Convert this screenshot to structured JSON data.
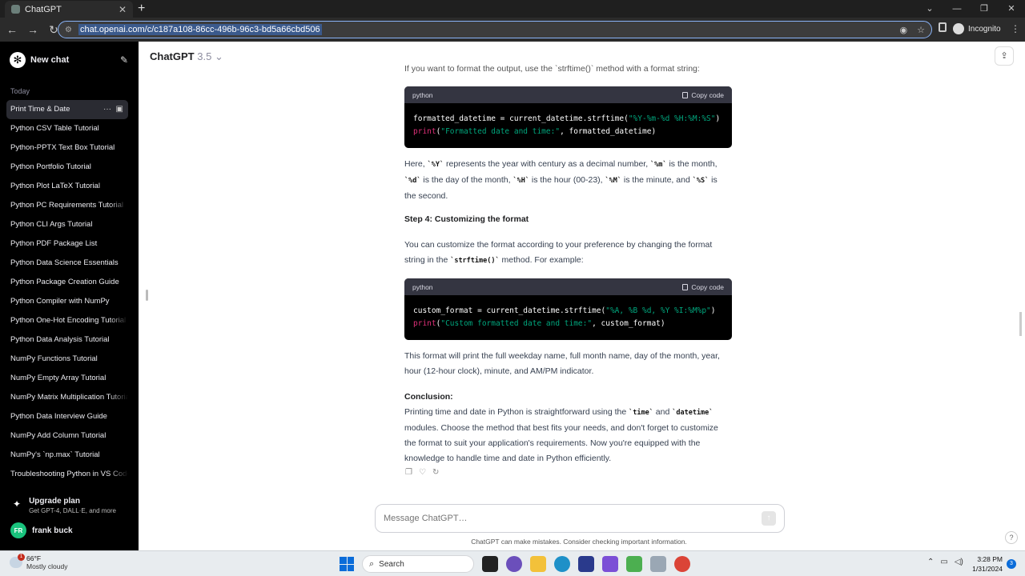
{
  "browser": {
    "tab_title": "ChatGPT",
    "url": "chat.openai.com/c/c187a108-86cc-496b-96c3-bd5a66cbd506",
    "profile_label": "Incognito"
  },
  "sidebar": {
    "new_chat_label": "New chat",
    "section_label": "Today",
    "items": [
      {
        "label": "Print Time & Date"
      },
      {
        "label": "Python CSV Table Tutorial"
      },
      {
        "label": "Python-PPTX Text Box Tutorial"
      },
      {
        "label": "Python Portfolio Tutorial"
      },
      {
        "label": "Python Plot LaTeX Tutorial"
      },
      {
        "label": "Python PC Requirements Tutorial"
      },
      {
        "label": "Python CLI Args Tutorial"
      },
      {
        "label": "Python PDF Package List"
      },
      {
        "label": "Python Data Science Essentials"
      },
      {
        "label": "Python Package Creation Guide"
      },
      {
        "label": "Python Compiler with NumPy"
      },
      {
        "label": "Python One-Hot Encoding Tutorial"
      },
      {
        "label": "Python Data Analysis Tutorial"
      },
      {
        "label": "NumPy Functions Tutorial"
      },
      {
        "label": "NumPy Empty Array Tutorial"
      },
      {
        "label": "NumPy Matrix Multiplication Tutorial"
      },
      {
        "label": "Python Data Interview Guide"
      },
      {
        "label": "NumPy Add Column Tutorial"
      },
      {
        "label": "NumPy's `np.max` Tutorial"
      },
      {
        "label": "Troubleshooting Python in VS Code"
      }
    ],
    "upgrade_title": "Upgrade plan",
    "upgrade_sub": "Get GPT-4, DALL·E, and more",
    "user_initials": "FR",
    "user_name": "frank buck"
  },
  "header": {
    "model_name": "ChatGPT",
    "model_version": "3.5"
  },
  "content": {
    "cut_line": "If you want to format the output, use the `strftime()` method with a format string:",
    "code1": {
      "lang": "python",
      "copy_label": "Copy code",
      "line1_a": "formatted_datetime = current_datetime.strftime(",
      "line1_str": "\"%Y-%m-%d %H:%M:%S\"",
      "line1_b": ")",
      "line2_fn": "print",
      "line2_a": "(",
      "line2_str": "\"Formatted date and time:\"",
      "line2_b": ", formatted_datetime)"
    },
    "para1": {
      "t1": "Here, ",
      "c1": "`%Y`",
      "t2": " represents the year with century as a decimal number, ",
      "c2": "`%m`",
      "t3": " is the month, ",
      "c3": "`%d`",
      "t4": " is the day of the month, ",
      "c4": "`%H`",
      "t5": " is the hour (00-23), ",
      "c5": "`%M`",
      "t6": " is the minute, and ",
      "c6": "`%S`",
      "t7": " is the second."
    },
    "step4_heading": "Step 4: Customizing the format",
    "para2": {
      "t1": "You can customize the format according to your preference by changing the format string in the ",
      "c1": "`strftime()`",
      "t2": " method. For example:"
    },
    "code2": {
      "lang": "python",
      "copy_label": "Copy code",
      "line1_a": "custom_format = current_datetime.strftime(",
      "line1_str": "\"%A, %B %d, %Y %I:%M%p\"",
      "line1_b": ")",
      "line2_fn": "print",
      "line2_a": "(",
      "line2_str": "\"Custom formatted date and time:\"",
      "line2_b": ", custom_format)"
    },
    "para3": "This format will print the full weekday name, full month name, day of the month, year, hour (12-hour clock), minute, and AM/PM indicator.",
    "conclusion_heading": "Conclusion:",
    "para4": {
      "t1": "Printing time and date in Python is straightforward using the ",
      "c1": "`time`",
      "t2": " and ",
      "c2": "`datetime`",
      "t3": " modules. Choose the method that best fits your needs, and don't forget to customize the format to suit your application's requirements. Now you're equipped with the knowledge to handle time and date in Python efficiently."
    }
  },
  "composer": {
    "placeholder": "Message ChatGPT…",
    "disclaimer": "ChatGPT can make mistakes. Consider checking important information."
  },
  "taskbar": {
    "temp": "66°F",
    "weather": "Mostly cloudy",
    "weather_badge": "1",
    "search_label": "Search",
    "time": "3:28 PM",
    "date": "1/31/2024",
    "notif_count": "3"
  }
}
